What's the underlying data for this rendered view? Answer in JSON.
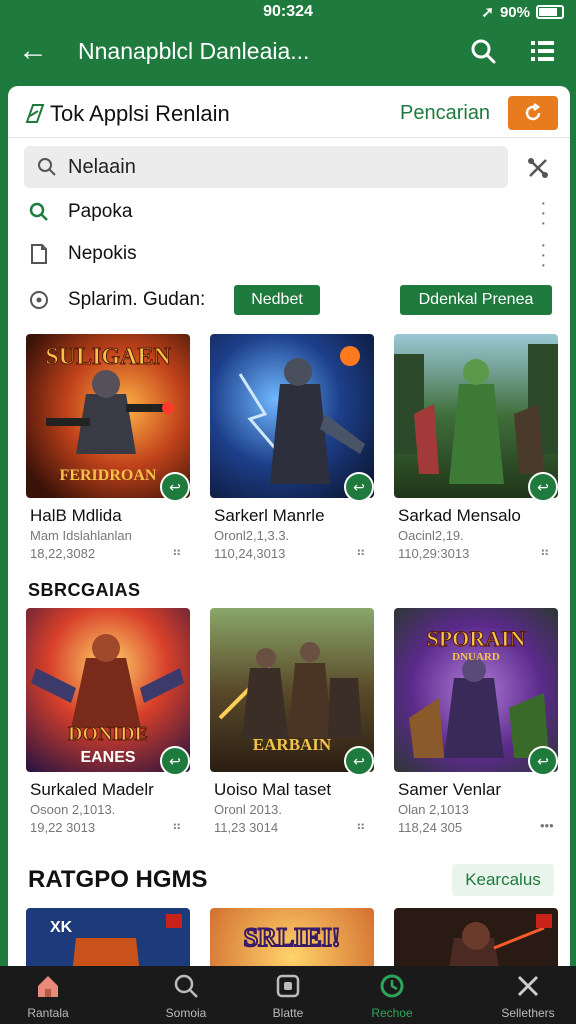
{
  "status": {
    "time": "90:324",
    "battery": "90%"
  },
  "appbar": {
    "title": "Nnanapblcl Danleaia..."
  },
  "sheet": {
    "title": "Tok Applsi Renlain",
    "search_link": "Pencarian"
  },
  "search": {
    "value": "Nelaain"
  },
  "list": [
    {
      "label": "Papoka",
      "icon": "search-icon"
    },
    {
      "label": "Nepokis",
      "icon": "file-icon"
    }
  ],
  "filter": {
    "label": "Splarim. Gudan:",
    "chip1": "Nedbet",
    "chip2": "Ddenkal Prenea"
  },
  "row1": [
    {
      "name": "HalB Mdlida",
      "sub": "Mam Idslahlanlan",
      "meta": "18,22,3082",
      "more": "⠶"
    },
    {
      "name": "Sarkerl Manrle",
      "sub": "Oronl2,1,3.3.",
      "meta": "110,24,3013",
      "more": "⠶"
    },
    {
      "name": "Sarkad Mensalo",
      "sub": "Oacinl2,19.",
      "meta": "110,29:3013",
      "more": "⠶"
    }
  ],
  "section1": "SBRCGAIAS",
  "row2": [
    {
      "name": "Surkaled Madelr",
      "sub": "Osoon 2,1013.",
      "meta": "19,22 3013",
      "more": "⠶"
    },
    {
      "name": "Uoiso Mal taset",
      "sub": "Oronl 2013.",
      "meta": "11,23 3014",
      "more": "⠶"
    },
    {
      "name": "Samer Venlar",
      "sub": "Olan 2,1013",
      "meta": "118,24 305",
      "more": "•••"
    }
  ],
  "section2": {
    "title": "RATGPO HGMS",
    "button": "Kearcalus"
  },
  "thumb_texts": {
    "t1_top": "SULIGAEN",
    "t1_bottom": "FERIDROAN",
    "t4_top": "DONIDE",
    "t4_bottom": "EANES",
    "t5_bottom": "EARBAIN",
    "t6_top": "SPORAIN",
    "t6_sub": "DNUARD",
    "t8_top": "SRLIEI!"
  },
  "nav": [
    {
      "label": "Rantala",
      "icon": "home-icon"
    },
    {
      "label": "Somoia",
      "icon": "search-icon"
    },
    {
      "label": "Blatte",
      "icon": "square-icon"
    },
    {
      "label": "Rechoe",
      "icon": "refresh-icon"
    },
    {
      "label": "Sellethers",
      "icon": "crossed-tools-icon"
    }
  ],
  "colors": {
    "brand": "#1f7a3d",
    "accent": "#e77b1e"
  }
}
